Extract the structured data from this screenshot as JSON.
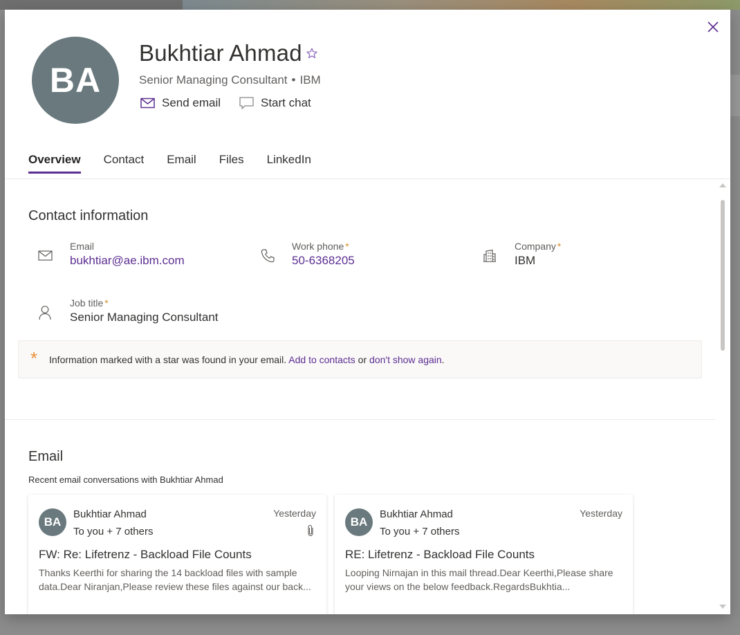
{
  "profile": {
    "initials": "BA",
    "name": "Bukhtiar Ahmad",
    "title": "Senior Managing Consultant",
    "separator": "•",
    "company": "IBM"
  },
  "actions": {
    "send_email": "Send email",
    "start_chat": "Start chat"
  },
  "tabs": [
    {
      "label": "Overview",
      "active": true
    },
    {
      "label": "Contact"
    },
    {
      "label": "Email"
    },
    {
      "label": "Files"
    },
    {
      "label": "LinkedIn"
    }
  ],
  "contact_info": {
    "heading": "Contact information",
    "required_mark": "*",
    "fields": {
      "email": {
        "label": "Email",
        "value": "bukhtiar@ae.ibm.com",
        "icon": "mail-icon"
      },
      "work_phone": {
        "label": "Work phone",
        "value": "50-6368205",
        "icon": "phone-icon"
      },
      "company": {
        "label": "Company",
        "value": "IBM",
        "icon": "building-icon"
      },
      "job_title": {
        "label": "Job title",
        "value": "Senior Managing Consultant",
        "icon": "person-icon"
      }
    },
    "notice": {
      "star": "*",
      "text": "Information marked with a star was found in your email. ",
      "add_link": "Add to contacts",
      "or": " or ",
      "dismiss_link": "don't show again",
      "period": "."
    }
  },
  "email_section": {
    "heading": "Email",
    "subheading": "Recent email conversations with Bukhtiar Ahmad",
    "cards": [
      {
        "initials": "BA",
        "sender": "Bukhtiar Ahmad",
        "recipients": "To you + 7 others",
        "date": "Yesterday",
        "has_attachment": true,
        "subject": "FW: Re: Lifetrenz - Backload File Counts",
        "preview": "Thanks Keerthi for sharing the 14 backload files with sample data.Dear Niranjan,Please review these files against our back..."
      },
      {
        "initials": "BA",
        "sender": "Bukhtiar Ahmad",
        "recipients": "To you + 7 others",
        "date": "Yesterday",
        "has_attachment": false,
        "subject": "RE: Lifetrenz - Backload File Counts",
        "preview": "Looping Nirnajan in this mail thread.Dear Keerthi,Please share your views on the below feedback.RegardsBukhtia..."
      }
    ]
  },
  "colors": {
    "accent": "#5c2e91",
    "avatar_bg": "#69797e",
    "required_star": "#d88f2f"
  }
}
